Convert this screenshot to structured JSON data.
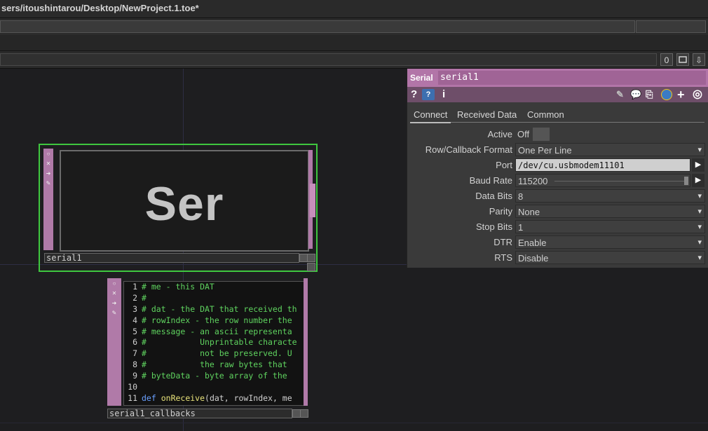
{
  "window": {
    "title": "sers/itoushintarou/Desktop/NewProject.1.toe*"
  },
  "toolbar": {
    "count": "0",
    "square_icon": "square-icon",
    "down_icon": "down-arrow-icon"
  },
  "serial_node": {
    "viewer_text": "Ser",
    "name": "serial1"
  },
  "dat_node": {
    "name": "serial1_callbacks",
    "lines": [
      {
        "n": "1",
        "text": "# me - this DAT"
      },
      {
        "n": "2",
        "text": "#"
      },
      {
        "n": "3",
        "text": "# dat - the DAT that received th"
      },
      {
        "n": "4",
        "text": "# rowIndex - the row number the"
      },
      {
        "n": "5",
        "text": "# message - an ascii representa"
      },
      {
        "n": "6",
        "text": "#           Unprintable characte"
      },
      {
        "n": "7",
        "text": "#           not be preserved. U"
      },
      {
        "n": "8",
        "text": "#           the raw bytes that"
      },
      {
        "n": "9",
        "text": "# byteData - byte array of the"
      },
      {
        "n": "10",
        "text": ""
      },
      {
        "n": "11",
        "kw": "def",
        "fn": "onReceive",
        "rest": "(dat, rowIndex, me"
      }
    ]
  },
  "panel": {
    "type_label": "Serial",
    "node_name": "serial1",
    "tabs": [
      "Connect",
      "Received Data",
      "Common"
    ],
    "params": [
      {
        "label": "Active",
        "value": "Off"
      },
      {
        "label": "Row/Callback Format",
        "value": "One Per Line"
      },
      {
        "label": "Port",
        "value": "/dev/cu.usbmodem11101"
      },
      {
        "label": "Baud Rate",
        "value": "115200"
      },
      {
        "label": "Data Bits",
        "value": "8"
      },
      {
        "label": "Parity",
        "value": "None"
      },
      {
        "label": "Stop Bits",
        "value": "1"
      },
      {
        "label": "DTR",
        "value": "Enable"
      },
      {
        "label": "RTS",
        "value": "Disable"
      }
    ]
  }
}
